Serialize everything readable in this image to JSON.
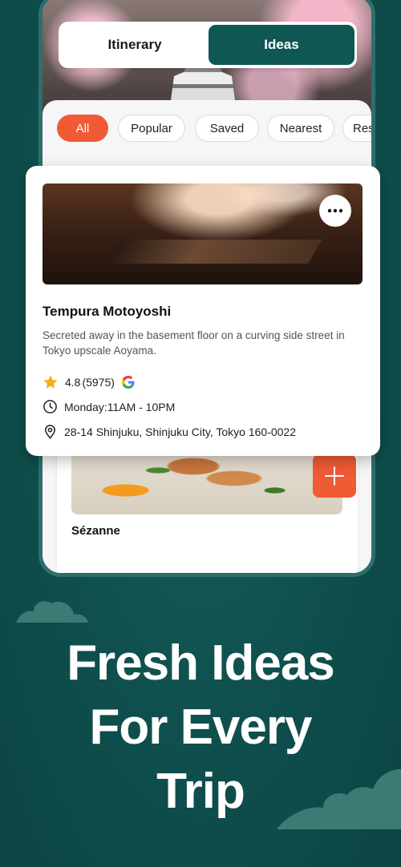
{
  "tabs": {
    "itinerary": "Itinerary",
    "ideas": "Ideas",
    "active": "Ideas"
  },
  "filters": [
    "All",
    "Popular",
    "Saved",
    "Nearest",
    "Rest"
  ],
  "featured": {
    "title": "Tempura Motoyoshi",
    "description": "Secreted away in the basement floor on a curving side street in Tokyo upscale Aoyama.",
    "rating": "4.8",
    "reviews": "(5975)",
    "hours": "Monday:11AM - 10PM",
    "address": "28-14 Shinjuku, Shinjuku City, Tokyo 160-0022"
  },
  "second": {
    "title": "Sézanne"
  },
  "headline": {
    "line1": "Fresh Ideas",
    "line2": "For Every",
    "line3": "Trip"
  },
  "colors": {
    "brand": "#0f5753",
    "accent": "#f05a35",
    "background": "#0f4f4d"
  }
}
